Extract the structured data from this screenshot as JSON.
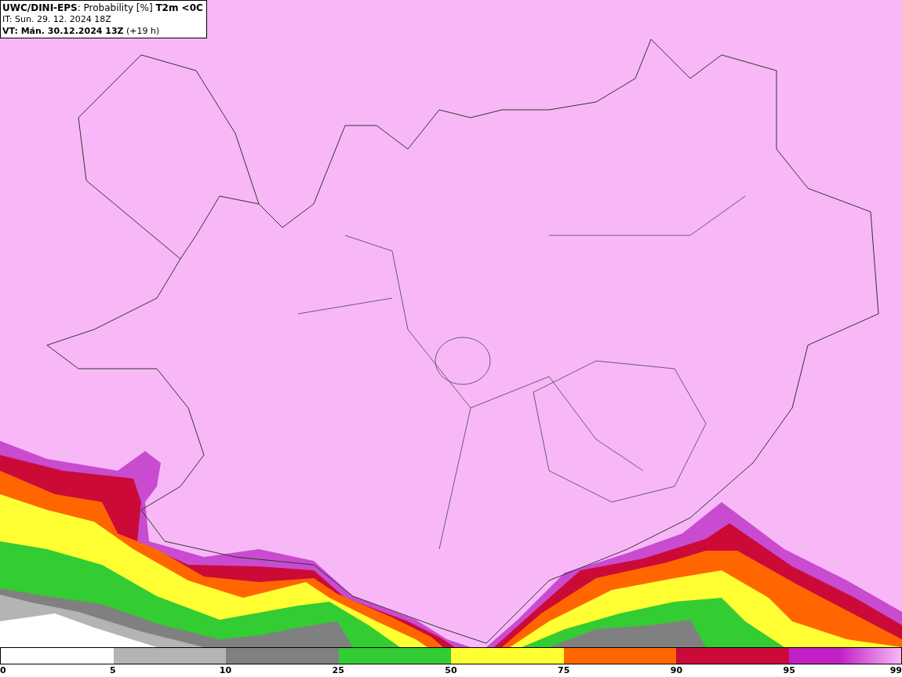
{
  "header": {
    "title": "**UWC/DINI-EPS**: Probability [%] **T2m <0C**",
    "init_time": "IT: Sun. 29. 12. 2024 18Z",
    "valid_time": "**VT: Mán. 30.12.2024 13Z** (+19 h)"
  },
  "legend": {
    "segments": [
      {
        "color": "#b4b4b4"
      },
      {
        "color": "#808080"
      },
      {
        "color": "#33cc33"
      },
      {
        "color": "#ffff33"
      },
      {
        "color": "#ff6600"
      },
      {
        "color": "#cc0a38"
      },
      {
        "color": "#c21fc4"
      }
    ],
    "labels": [
      "0",
      "5",
      "10",
      "25",
      "50",
      "75",
      "90",
      "95",
      "99"
    ]
  }
}
